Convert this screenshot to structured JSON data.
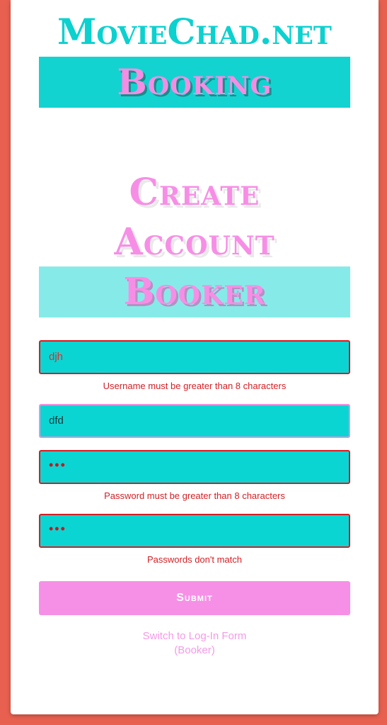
{
  "site": {
    "title": "MovieChad.net",
    "section": "Booking"
  },
  "heading": {
    "line1": "Create",
    "line2": "Account",
    "role": "Booker"
  },
  "form": {
    "username": {
      "value": "djh",
      "error": "Username must be greater than 8 characters"
    },
    "email": {
      "value": "dfd"
    },
    "password": {
      "value": "•••",
      "error": "Password must be greater than 8 characters"
    },
    "confirm_password": {
      "value": "•••",
      "error": "Passwords don't match"
    },
    "submit_label": "Submit"
  },
  "switch_link": {
    "line1": "Switch to Log-In Form",
    "line2": "(Booker)"
  },
  "colors": {
    "background": "#e8604f",
    "accent_teal": "#0bd5d3",
    "accent_pink": "#f690e6",
    "error_red": "#d41f24"
  }
}
